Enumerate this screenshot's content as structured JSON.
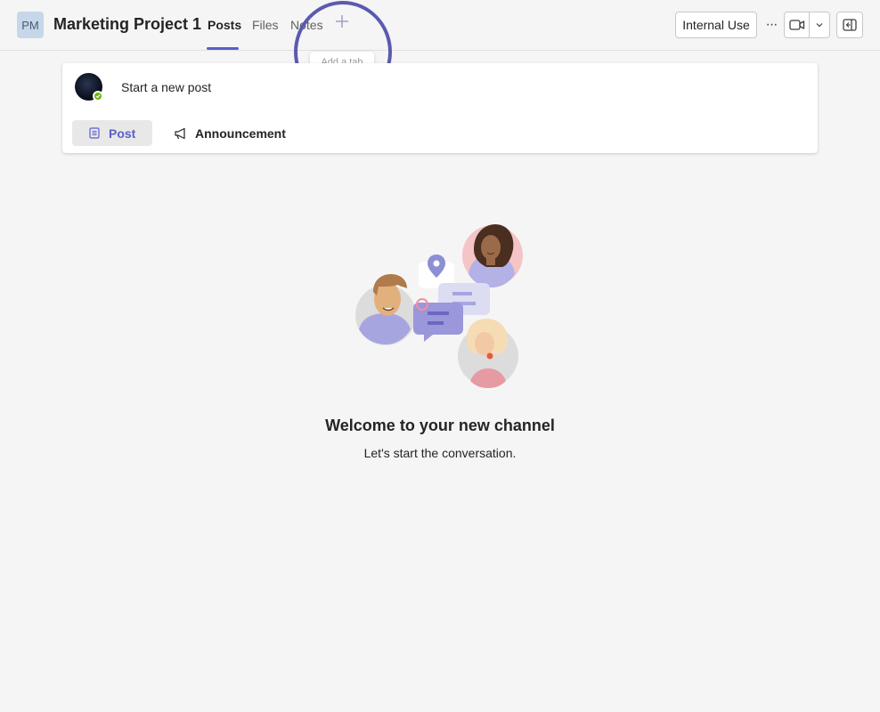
{
  "header": {
    "team_initials": "PM",
    "channel_title": "Marketing Project 1",
    "tabs": [
      {
        "label": "Posts",
        "active": true
      },
      {
        "label": "Files",
        "active": false
      },
      {
        "label": "Notes",
        "active": false
      }
    ],
    "add_tab_icon": "plus-icon",
    "add_tab_tooltip": "Add a tab",
    "sensitivity_label": "Internal Use",
    "more_icon": "more-horizontal-icon",
    "more_glyph": "···",
    "meet_icon": "video-camera-icon",
    "meet_dropdown_icon": "chevron-down-icon",
    "panel_icon": "side-panel-icon"
  },
  "compose": {
    "placeholder": "Start a new post",
    "post_label": "Post",
    "post_icon": "document-icon",
    "announcement_label": "Announcement",
    "announcement_icon": "megaphone-icon",
    "presence_status": "available"
  },
  "empty_state": {
    "title": "Welcome to your new channel",
    "subtitle": "Let's start the conversation."
  },
  "colors": {
    "accent": "#5b5fc7",
    "background": "#f5f5f5",
    "presence_available": "#6bb700",
    "highlight_ring": "#5b5ab0"
  }
}
